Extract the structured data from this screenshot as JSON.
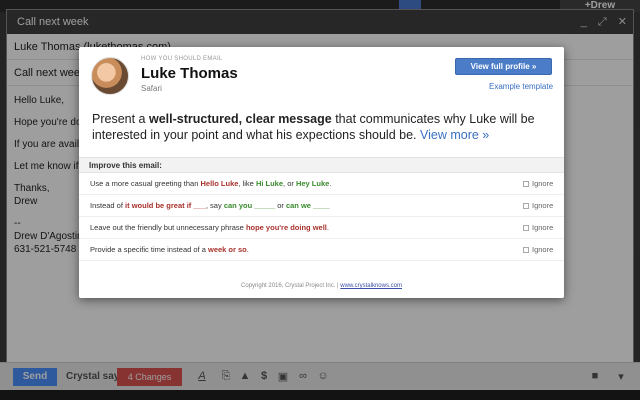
{
  "topbar": {
    "account": "+Drew"
  },
  "compose": {
    "title": "Call next week",
    "to": "Luke Thomas (lukethomas.com)",
    "subject": "Call next week",
    "body_lines": [
      "Hello Luke,",
      "Hope you're doing",
      "If you are available",
      "Let me know if tha",
      "Thanks,\nDrew",
      "--\nDrew D'Agostino\n631-521-5748"
    ]
  },
  "modal": {
    "how_label": "HOW YOU SHOULD EMAIL",
    "name": "Luke Thomas",
    "browser": "Safari",
    "view_profile": "View full profile »",
    "example_template": "Example template",
    "summary": {
      "pre": "Present a ",
      "bold": "well-structured, clear message",
      "post": " that communicates why Luke will be interested in your point and what his expections should be. ",
      "more": "View more »"
    },
    "improve_title": "Improve this email:",
    "ignore_label": "Ignore",
    "suggestions": [
      {
        "parts": [
          "Use a more casual greeting than ",
          "Hello Luke",
          ", like ",
          "Hi Luke",
          ", or ",
          "Hey Luke",
          "."
        ]
      },
      {
        "parts": [
          "Instead of ",
          "it would be great if ___",
          ", say ",
          "can you _____",
          " or ",
          "can we ____",
          ""
        ]
      },
      {
        "parts": [
          "Leave out the friendly but unnecessary phrase ",
          "hope you're doing well",
          "."
        ]
      },
      {
        "parts": [
          "Provide a specific time instead of a ",
          "week or so",
          "."
        ]
      }
    ],
    "copyright": "Copyright 2016, Crystal Project Inc. | ",
    "site": "www.crystalknows.com"
  },
  "toolbar": {
    "send": "Send",
    "crystal_says": "Crystal says:",
    "changes": "4 Changes"
  },
  "icons": [
    "format-icon",
    "attach-icon",
    "drive-icon",
    "money-icon",
    "photo-icon",
    "link-icon",
    "emoji-icon",
    "trash-icon",
    "more-options-icon"
  ],
  "colors": {
    "accent": "#4d90fe",
    "alert": "#d9534f",
    "red_text": "#a8322d",
    "green_text": "#3a8a2e"
  }
}
